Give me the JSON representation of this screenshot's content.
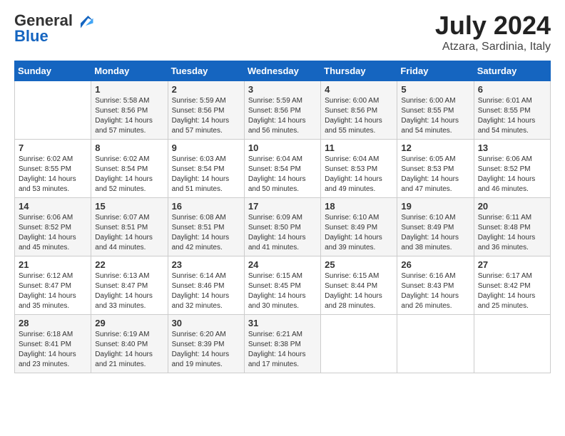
{
  "logo": {
    "general": "General",
    "blue": "Blue"
  },
  "title": {
    "month_year": "July 2024",
    "location": "Atzara, Sardinia, Italy"
  },
  "headers": [
    "Sunday",
    "Monday",
    "Tuesday",
    "Wednesday",
    "Thursday",
    "Friday",
    "Saturday"
  ],
  "weeks": [
    [
      {
        "day": "",
        "info": ""
      },
      {
        "day": "1",
        "info": "Sunrise: 5:58 AM\nSunset: 8:56 PM\nDaylight: 14 hours\nand 57 minutes."
      },
      {
        "day": "2",
        "info": "Sunrise: 5:59 AM\nSunset: 8:56 PM\nDaylight: 14 hours\nand 57 minutes."
      },
      {
        "day": "3",
        "info": "Sunrise: 5:59 AM\nSunset: 8:56 PM\nDaylight: 14 hours\nand 56 minutes."
      },
      {
        "day": "4",
        "info": "Sunrise: 6:00 AM\nSunset: 8:56 PM\nDaylight: 14 hours\nand 55 minutes."
      },
      {
        "day": "5",
        "info": "Sunrise: 6:00 AM\nSunset: 8:55 PM\nDaylight: 14 hours\nand 54 minutes."
      },
      {
        "day": "6",
        "info": "Sunrise: 6:01 AM\nSunset: 8:55 PM\nDaylight: 14 hours\nand 54 minutes."
      }
    ],
    [
      {
        "day": "7",
        "info": "Sunrise: 6:02 AM\nSunset: 8:55 PM\nDaylight: 14 hours\nand 53 minutes."
      },
      {
        "day": "8",
        "info": "Sunrise: 6:02 AM\nSunset: 8:54 PM\nDaylight: 14 hours\nand 52 minutes."
      },
      {
        "day": "9",
        "info": "Sunrise: 6:03 AM\nSunset: 8:54 PM\nDaylight: 14 hours\nand 51 minutes."
      },
      {
        "day": "10",
        "info": "Sunrise: 6:04 AM\nSunset: 8:54 PM\nDaylight: 14 hours\nand 50 minutes."
      },
      {
        "day": "11",
        "info": "Sunrise: 6:04 AM\nSunset: 8:53 PM\nDaylight: 14 hours\nand 49 minutes."
      },
      {
        "day": "12",
        "info": "Sunrise: 6:05 AM\nSunset: 8:53 PM\nDaylight: 14 hours\nand 47 minutes."
      },
      {
        "day": "13",
        "info": "Sunrise: 6:06 AM\nSunset: 8:52 PM\nDaylight: 14 hours\nand 46 minutes."
      }
    ],
    [
      {
        "day": "14",
        "info": "Sunrise: 6:06 AM\nSunset: 8:52 PM\nDaylight: 14 hours\nand 45 minutes."
      },
      {
        "day": "15",
        "info": "Sunrise: 6:07 AM\nSunset: 8:51 PM\nDaylight: 14 hours\nand 44 minutes."
      },
      {
        "day": "16",
        "info": "Sunrise: 6:08 AM\nSunset: 8:51 PM\nDaylight: 14 hours\nand 42 minutes."
      },
      {
        "day": "17",
        "info": "Sunrise: 6:09 AM\nSunset: 8:50 PM\nDaylight: 14 hours\nand 41 minutes."
      },
      {
        "day": "18",
        "info": "Sunrise: 6:10 AM\nSunset: 8:49 PM\nDaylight: 14 hours\nand 39 minutes."
      },
      {
        "day": "19",
        "info": "Sunrise: 6:10 AM\nSunset: 8:49 PM\nDaylight: 14 hours\nand 38 minutes."
      },
      {
        "day": "20",
        "info": "Sunrise: 6:11 AM\nSunset: 8:48 PM\nDaylight: 14 hours\nand 36 minutes."
      }
    ],
    [
      {
        "day": "21",
        "info": "Sunrise: 6:12 AM\nSunset: 8:47 PM\nDaylight: 14 hours\nand 35 minutes."
      },
      {
        "day": "22",
        "info": "Sunrise: 6:13 AM\nSunset: 8:47 PM\nDaylight: 14 hours\nand 33 minutes."
      },
      {
        "day": "23",
        "info": "Sunrise: 6:14 AM\nSunset: 8:46 PM\nDaylight: 14 hours\nand 32 minutes."
      },
      {
        "day": "24",
        "info": "Sunrise: 6:15 AM\nSunset: 8:45 PM\nDaylight: 14 hours\nand 30 minutes."
      },
      {
        "day": "25",
        "info": "Sunrise: 6:15 AM\nSunset: 8:44 PM\nDaylight: 14 hours\nand 28 minutes."
      },
      {
        "day": "26",
        "info": "Sunrise: 6:16 AM\nSunset: 8:43 PM\nDaylight: 14 hours\nand 26 minutes."
      },
      {
        "day": "27",
        "info": "Sunrise: 6:17 AM\nSunset: 8:42 PM\nDaylight: 14 hours\nand 25 minutes."
      }
    ],
    [
      {
        "day": "28",
        "info": "Sunrise: 6:18 AM\nSunset: 8:41 PM\nDaylight: 14 hours\nand 23 minutes."
      },
      {
        "day": "29",
        "info": "Sunrise: 6:19 AM\nSunset: 8:40 PM\nDaylight: 14 hours\nand 21 minutes."
      },
      {
        "day": "30",
        "info": "Sunrise: 6:20 AM\nSunset: 8:39 PM\nDaylight: 14 hours\nand 19 minutes."
      },
      {
        "day": "31",
        "info": "Sunrise: 6:21 AM\nSunset: 8:38 PM\nDaylight: 14 hours\nand 17 minutes."
      },
      {
        "day": "",
        "info": ""
      },
      {
        "day": "",
        "info": ""
      },
      {
        "day": "",
        "info": ""
      }
    ]
  ]
}
